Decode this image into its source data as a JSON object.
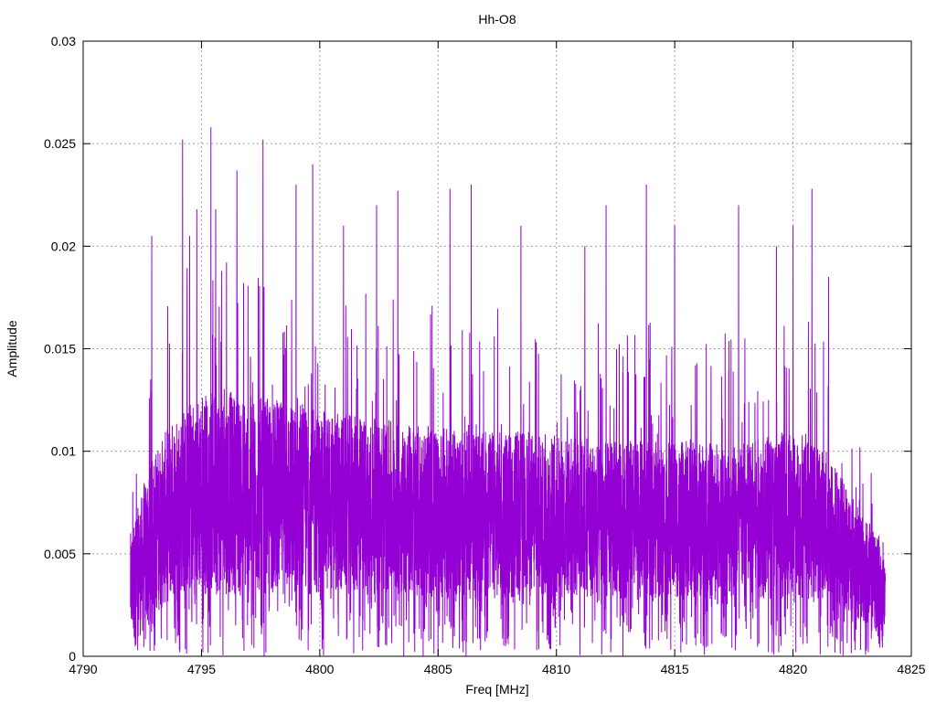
{
  "chart_data": {
    "type": "line",
    "title": "Hh-O8",
    "xlabel": "Freq [MHz]",
    "ylabel": "Amplitude",
    "xlim": [
      4790,
      4825
    ],
    "ylim": [
      0,
      0.03
    ],
    "x_ticks": [
      4790,
      4795,
      4800,
      4805,
      4810,
      4815,
      4820,
      4825
    ],
    "x_tick_labels": [
      "4790",
      "4795",
      "4800",
      "4805",
      "4810",
      "4815",
      "4820",
      "4825"
    ],
    "y_ticks": [
      0,
      0.005,
      0.01,
      0.015,
      0.02,
      0.025,
      0.03
    ],
    "y_tick_labels": [
      "0",
      "0.005",
      "0.01",
      "0.015",
      "0.02",
      "0.025",
      "0.03"
    ],
    "grid": true,
    "legend": "none",
    "color": "#9400d3",
    "series": [
      {
        "x_range": [
          4792.0,
          4823.9
        ],
        "envelope_x": [
          4792.0,
          4792.5,
          4793.0,
          4794.0,
          4795.0,
          4796.0,
          4798.0,
          4800.0,
          4803.0,
          4806.0,
          4809.0,
          4812.0,
          4815.0,
          4818.0,
          4820.0,
          4821.5,
          4822.5,
          4823.0,
          4823.5,
          4823.9
        ],
        "typical_low": [
          0.0008,
          0.001,
          0.002,
          0.003,
          0.003,
          0.003,
          0.003,
          0.003,
          0.003,
          0.0028,
          0.0028,
          0.0028,
          0.0028,
          0.0028,
          0.0028,
          0.0028,
          0.002,
          0.0015,
          0.001,
          0.0008
        ],
        "typical_high": [
          0.006,
          0.008,
          0.01,
          0.012,
          0.013,
          0.013,
          0.0125,
          0.012,
          0.0115,
          0.011,
          0.011,
          0.0105,
          0.0105,
          0.0105,
          0.011,
          0.01,
          0.008,
          0.007,
          0.006,
          0.005
        ],
        "peaks": [
          {
            "x": 4792.9,
            "y": 0.0205
          },
          {
            "x": 4794.2,
            "y": 0.0252
          },
          {
            "x": 4794.5,
            "y": 0.0205
          },
          {
            "x": 4794.8,
            "y": 0.0218
          },
          {
            "x": 4795.4,
            "y": 0.0258
          },
          {
            "x": 4795.6,
            "y": 0.0218
          },
          {
            "x": 4796.5,
            "y": 0.0237
          },
          {
            "x": 4797.6,
            "y": 0.0252
          },
          {
            "x": 4799.0,
            "y": 0.023
          },
          {
            "x": 4799.7,
            "y": 0.024
          },
          {
            "x": 4801.0,
            "y": 0.021
          },
          {
            "x": 4802.4,
            "y": 0.022
          },
          {
            "x": 4803.3,
            "y": 0.0227
          },
          {
            "x": 4805.5,
            "y": 0.0228
          },
          {
            "x": 4806.4,
            "y": 0.023
          },
          {
            "x": 4808.5,
            "y": 0.021
          },
          {
            "x": 4811.2,
            "y": 0.02
          },
          {
            "x": 4812.1,
            "y": 0.022
          },
          {
            "x": 4813.8,
            "y": 0.023
          },
          {
            "x": 4815.0,
            "y": 0.021
          },
          {
            "x": 4817.7,
            "y": 0.022
          },
          {
            "x": 4819.3,
            "y": 0.02
          },
          {
            "x": 4820.0,
            "y": 0.021
          },
          {
            "x": 4820.8,
            "y": 0.0228
          },
          {
            "x": 4821.5,
            "y": 0.0185
          }
        ]
      }
    ]
  }
}
